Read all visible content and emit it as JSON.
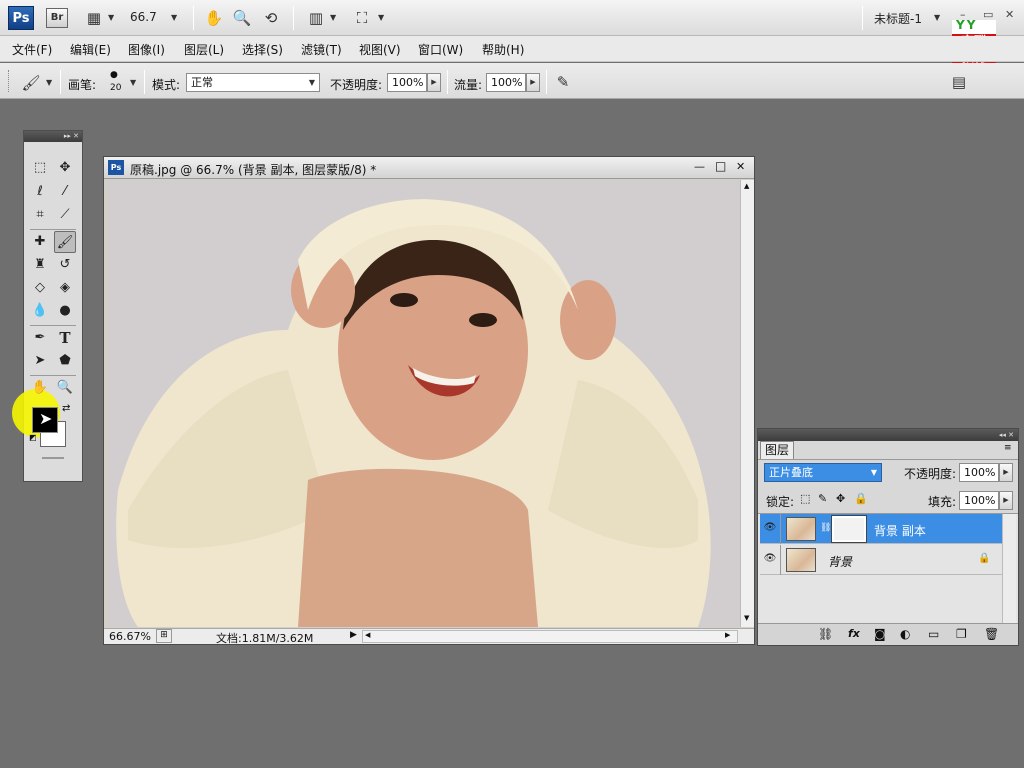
{
  "app": {
    "logo": "Ps",
    "bridge": "Br",
    "zoom": "66.7",
    "doc_title": "未标题-1",
    "brand_top": "YY",
    "brand_line1": "育碟",
    "brand_line2": "教育"
  },
  "menu": [
    "文件(F)",
    "编辑(E)",
    "图像(I)",
    "图层(L)",
    "选择(S)",
    "滤镜(T)",
    "视图(V)",
    "窗口(W)",
    "帮助(H)"
  ],
  "options": {
    "brush_label": "画笔:",
    "brush_size": "20",
    "mode_label": "模式:",
    "mode_value": "正常",
    "opacity_label": "不透明度:",
    "opacity_value": "100%",
    "flow_label": "流量:",
    "flow_value": "100%"
  },
  "document": {
    "title": "原稿.jpg @ 66.7% (背景 副本, 图层蒙版/8) *",
    "zoom": "66.67%",
    "doc_info": "文档:1.81M/3.62M",
    "win_min": "—",
    "win_max": "□",
    "win_close": "✕"
  },
  "layers_panel": {
    "tab": "图层",
    "blend_mode": "正片叠底",
    "opacity_label": "不透明度:",
    "opacity_value": "100%",
    "lock_label": "锁定:",
    "fill_label": "填充:",
    "fill_value": "100%",
    "layers": [
      {
        "name": "背景 副本",
        "active": true
      },
      {
        "name": "背景",
        "active": false
      }
    ],
    "footer_icons": [
      "link-icon",
      "fx-icon",
      "mask-icon",
      "adjustment-icon",
      "group-icon",
      "new-layer-icon",
      "trash-icon"
    ],
    "fx": "fx"
  },
  "colors": {
    "accent": "#3b8ee3",
    "workspace": "#6f6f6f",
    "highlight": "#f5f500"
  }
}
